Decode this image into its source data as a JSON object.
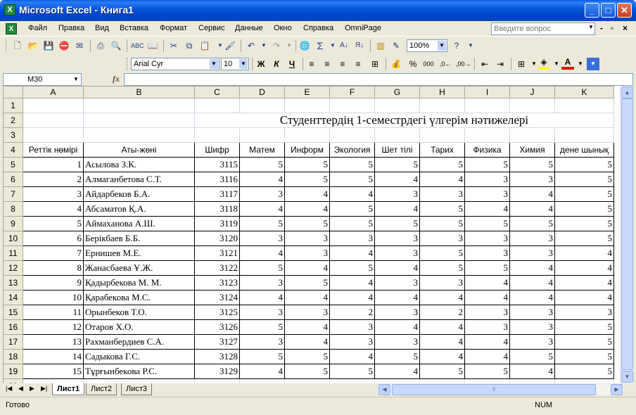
{
  "window": {
    "title": "Microsoft Excel - Книга1",
    "app_icon": "X"
  },
  "menu": {
    "items": [
      "Файл",
      "Правка",
      "Вид",
      "Вставка",
      "Формат",
      "Сервис",
      "Данные",
      "Окно",
      "Справка",
      "OmniPage"
    ],
    "question_placeholder": "Введите вопрос"
  },
  "toolbar": {
    "zoom": "100%",
    "font_name": "Arial Cyr",
    "font_size": "10",
    "bold": "Ж",
    "italic": "К",
    "underline": "Ч",
    "percent": "%",
    "thousands": "000",
    "fill_color": "#ffff00",
    "font_color": "#ff0000"
  },
  "formula": {
    "name_box": "M30",
    "fx": "fx",
    "value": ""
  },
  "columns": [
    "A",
    "B",
    "C",
    "D",
    "E",
    "F",
    "G",
    "H",
    "I",
    "J",
    "K"
  ],
  "rows": [
    "1",
    "2",
    "3",
    "4",
    "5",
    "6",
    "7",
    "8",
    "9",
    "10",
    "11",
    "12",
    "13",
    "14",
    "15",
    "16",
    "17",
    "18",
    "19",
    "20"
  ],
  "sheet": {
    "title": "Студенттердің  1-семестрдегі үлгерім нәтижелері",
    "headers": [
      "Реттік нөмірі",
      "Аты-жөні",
      "Шифр",
      "Матем",
      "Информ",
      "Экология",
      "Шет тілі",
      "Тарих",
      "Физика",
      "Химия",
      "дене шынық"
    ],
    "students": [
      [
        "1",
        "Асылова З.К.",
        "3115",
        "5",
        "5",
        "5",
        "5",
        "5",
        "5",
        "5",
        "5"
      ],
      [
        "2",
        "Алмаганбетова С.Т.",
        "3116",
        "4",
        "5",
        "5",
        "4",
        "4",
        "3",
        "3",
        "5"
      ],
      [
        "3",
        "Айдарбеков Б.А.",
        "3117",
        "3",
        "4",
        "4",
        "3",
        "3",
        "3",
        "4",
        "5"
      ],
      [
        "4",
        "Абсаматов Қ.А.",
        "3118",
        "4",
        "4",
        "5",
        "4",
        "5",
        "4",
        "4",
        "5"
      ],
      [
        "5",
        "Аймаханова А.Ш.",
        "3119",
        "5",
        "5",
        "5",
        "5",
        "5",
        "5",
        "5",
        "5"
      ],
      [
        "6",
        "Берікбаев Б.Б.",
        "3120",
        "3",
        "3",
        "3",
        "3",
        "3",
        "3",
        "3",
        "5"
      ],
      [
        "7",
        "Ернишев М.Е.",
        "3121",
        "4",
        "3",
        "4",
        "3",
        "5",
        "3",
        "3",
        "4"
      ],
      [
        "8",
        "Жанасбаева Ұ.Ж.",
        "3122",
        "5",
        "4",
        "5",
        "4",
        "5",
        "5",
        "4",
        "4"
      ],
      [
        "9",
        "Қадырбекова М. М.",
        "3123",
        "3",
        "5",
        "4",
        "3",
        "3",
        "4",
        "4",
        "4"
      ],
      [
        "10",
        "Қарабекова М.С.",
        "3124",
        "4",
        "4",
        "4",
        "4",
        "4",
        "4",
        "4",
        "4"
      ],
      [
        "11",
        "Орынбеков Т.О.",
        "3125",
        "3",
        "3",
        "2",
        "3",
        "2",
        "3",
        "3",
        "3"
      ],
      [
        "12",
        "Отаров Х.О.",
        "3126",
        "5",
        "4",
        "3",
        "4",
        "4",
        "3",
        "3",
        "5"
      ],
      [
        "13",
        "Рахманбердиев С.А.",
        "3127",
        "3",
        "4",
        "3",
        "3",
        "4",
        "4",
        "3",
        "5"
      ],
      [
        "14",
        "Садыкова Г.С.",
        "3128",
        "5",
        "5",
        "4",
        "5",
        "4",
        "4",
        "5",
        "5"
      ],
      [
        "15",
        "Тұрғынбекова Р.С.",
        "3129",
        "4",
        "5",
        "5",
        "4",
        "5",
        "5",
        "4",
        "5"
      ]
    ]
  },
  "tabs": [
    "Лист1",
    "Лист2",
    "Лист3"
  ],
  "status": {
    "text": "Готово",
    "num": "NUM"
  }
}
